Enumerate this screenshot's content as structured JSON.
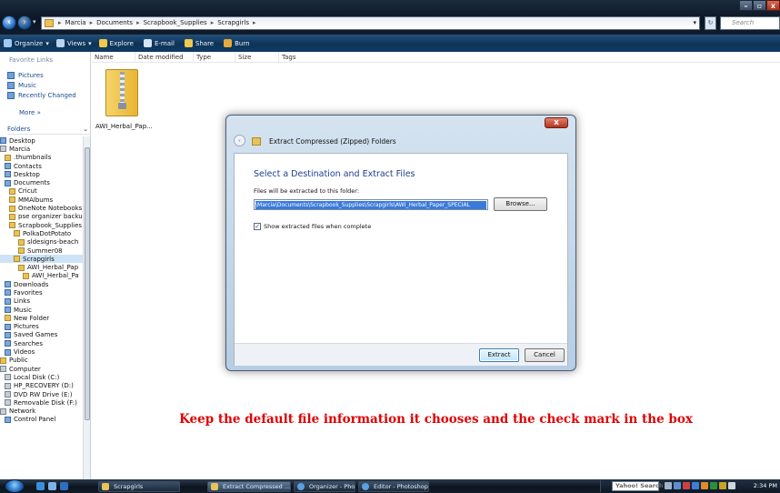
{
  "address": {
    "crumbs": [
      "Marcia",
      "Documents",
      "Scrapbook_Supplies",
      "Scrapgirls"
    ],
    "search_placeholder": "Search"
  },
  "toolbar": {
    "items": [
      {
        "label": "Organize",
        "icon": "organize-icon",
        "color": "#9ec9f2"
      },
      {
        "label": "Views",
        "icon": "views-icon",
        "color": "#b7d4f0"
      },
      {
        "label": "Explore",
        "icon": "explore-icon",
        "color": "#f0c84a"
      },
      {
        "label": "E-mail",
        "icon": "email-icon",
        "color": "#d6e5f5"
      },
      {
        "label": "Share",
        "icon": "share-icon",
        "color": "#f2c94c"
      },
      {
        "label": "Burn",
        "icon": "burn-icon",
        "color": "#e6a93b"
      }
    ]
  },
  "sidebar": {
    "favorites_title": "Favorite Links",
    "favorites": [
      "Pictures",
      "Music",
      "Recently Changed"
    ],
    "more_label": "More »",
    "folders_label": "Folders",
    "tree": [
      "Desktop",
      "Marcia",
      ".thumbnails",
      "Contacts",
      "Desktop",
      "Documents",
      "Cricut",
      "MMAlbums",
      "OneNote Notebooks",
      "pse organizer backup",
      "Scrapbook_Supplies",
      "PolkaDotPotato",
      "sldesigns-beach",
      "Summer08",
      "Scrapgirls",
      "AWI_Herbal_Pap",
      "AWI_Herbal_Pa",
      "Downloads",
      "Favorites",
      "Links",
      "Music",
      "New Folder",
      "Pictures",
      "Saved Games",
      "Searches",
      "Videos",
      "Public",
      "Computer",
      "Local Disk (C:)",
      "HP_RECOVERY (D:)",
      "DVD RW Drive (E:)",
      "Removable Disk (F:)",
      "Network",
      "Control Panel"
    ]
  },
  "columns": [
    "Name",
    "Date modified",
    "Type",
    "Size",
    "Tags"
  ],
  "file": {
    "name": "AWI_Herbal_Pap..."
  },
  "dialog": {
    "title": "Extract Compressed (Zipped) Folders",
    "heading": "Select a Destination and Extract Files",
    "dest_label": "Files will be extracted to this folder:",
    "dest_value": "\\Marcia\\Documents\\Scrapbook_Supplies\\Scrapgirls\\AWI_Herbal_Paper_SPECIAL",
    "browse": "Browse...",
    "checkbox_label": "Show extracted files when complete",
    "checkbox_checked": true,
    "extract": "Extract",
    "cancel": "Cancel"
  },
  "instruction": "Keep the default file information it chooses and the check mark in the box",
  "taskbar": {
    "tasks": [
      "Scrapgirls",
      "Extract Compressed ...",
      "Organizer - Photosh...",
      "Editor - Photoshop ..."
    ],
    "search": "Yahoo! Search",
    "clock": "2:34 PM"
  }
}
